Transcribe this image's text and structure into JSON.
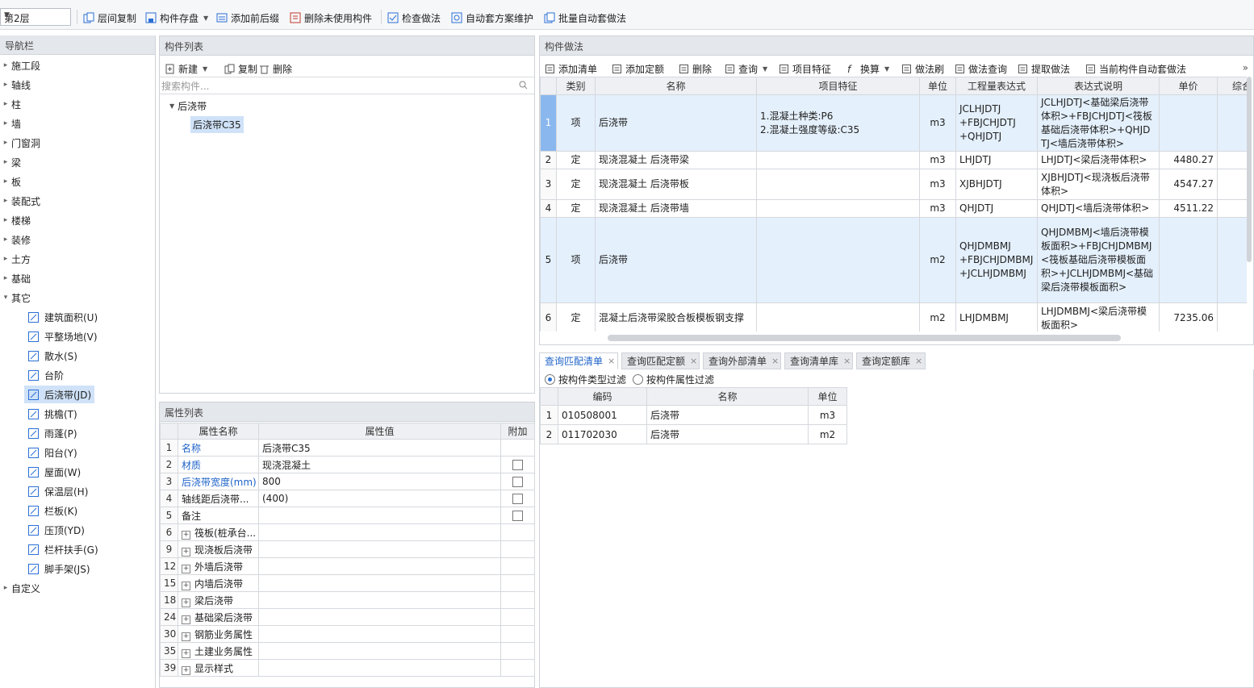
{
  "toolbar": {
    "floor": "第2层",
    "items": [
      "层间复制",
      "构件存盘",
      "添加前后缀",
      "删除未使用构件",
      "检查做法",
      "自动套方案维护",
      "批量自动套做法"
    ]
  },
  "nav": {
    "title": "导航栏",
    "items": [
      "施工段",
      "轴线",
      "柱",
      "墙",
      "门窗洞",
      "梁",
      "板",
      "装配式",
      "楼梯",
      "装修",
      "土方",
      "基础",
      "其它"
    ],
    "sub_items": [
      "建筑面积(U)",
      "平整场地(V)",
      "散水(S)",
      "台阶",
      "后浇带(JD)",
      "挑檐(T)",
      "雨蓬(P)",
      "阳台(Y)",
      "屋面(W)",
      "保温层(H)",
      "栏板(K)",
      "压顶(YD)",
      "栏杆扶手(G)",
      "脚手架(JS)"
    ],
    "custom": "自定义"
  },
  "component_list": {
    "title": "构件列表",
    "new": "新建",
    "copy": "复制",
    "delete": "删除",
    "search_placeholder": "搜索构件...",
    "tree_parent": "后浇带",
    "tree_child": "后浇带C35"
  },
  "property_list": {
    "title": "属性列表",
    "headers": [
      "属性名称",
      "属性值",
      "附加"
    ],
    "rows": [
      {
        "no": "1",
        "name": "名称",
        "value": "后浇带C35"
      },
      {
        "no": "2",
        "name": "材质",
        "value": "现浇混凝土"
      },
      {
        "no": "3",
        "name": "后浇带宽度(mm)",
        "value": "800"
      },
      {
        "no": "4",
        "name": "轴线距后浇带...",
        "value": "(400)"
      },
      {
        "no": "5",
        "name": "备注",
        "value": ""
      },
      {
        "no": "6",
        "name": "筏板(桩承台...",
        "value": ""
      },
      {
        "no": "9",
        "name": "现浇板后浇带",
        "value": ""
      },
      {
        "no": "12",
        "name": "外墙后浇带",
        "value": ""
      },
      {
        "no": "15",
        "name": "内墙后浇带",
        "value": ""
      },
      {
        "no": "18",
        "name": "梁后浇带",
        "value": ""
      },
      {
        "no": "24",
        "name": "基础梁后浇带",
        "value": ""
      },
      {
        "no": "30",
        "name": "钢筋业务属性",
        "value": ""
      },
      {
        "no": "35",
        "name": "土建业务属性",
        "value": ""
      },
      {
        "no": "39",
        "name": "显示样式",
        "value": ""
      }
    ]
  },
  "method": {
    "title": "构件做法",
    "toolbar": [
      "添加清单",
      "添加定额",
      "删除",
      "查询",
      "项目特征",
      "换算",
      "做法刷",
      "做法查询",
      "提取做法",
      "当前构件自动套做法"
    ],
    "headers": [
      "类别",
      "名称",
      "项目特征",
      "单位",
      "工程量表达式",
      "表达式说明",
      "单价",
      "综合"
    ],
    "rows": [
      {
        "no": "1",
        "type": "项",
        "name": "后浇带",
        "feature": "1.混凝土种类:P6\n2.混凝土强度等级:C35",
        "unit": "m3",
        "expr": "JCLHJDTJ\n+FBJCHJDTJ\n+QHJDTJ",
        "desc": "JCLHJDTJ<基础梁后浇带体积>+FBJCHJDTJ<筏板基础后浇带体积>+QHJDTJ<墙后浇带体积>",
        "price": ""
      },
      {
        "no": "2",
        "type": "定",
        "name": "现浇混凝土 后浇带梁",
        "feature": "",
        "unit": "m3",
        "expr": "LHJDTJ",
        "desc": "LHJDTJ<梁后浇带体积>",
        "price": "4480.27"
      },
      {
        "no": "3",
        "type": "定",
        "name": "现浇混凝土 后浇带板",
        "feature": "",
        "unit": "m3",
        "expr": "XJBHJDTJ",
        "desc": "XJBHJDTJ<现浇板后浇带体积>",
        "price": "4547.27"
      },
      {
        "no": "4",
        "type": "定",
        "name": "现浇混凝土 后浇带墙",
        "feature": "",
        "unit": "m3",
        "expr": "QHJDTJ",
        "desc": "QHJDTJ<墙后浇带体积>",
        "price": "4511.22"
      },
      {
        "no": "5",
        "type": "项",
        "name": "后浇带",
        "feature": "",
        "unit": "m2",
        "expr": "QHJDMBMJ\n+FBJCHJDMBMJ\n+JCLHJDMBMJ",
        "desc": "QHJDMBMJ<墙后浇带模板面积>+FBJCHJDMBMJ<筏板基础后浇带模板面积>+JCLHJDMBMJ<基础梁后浇带模板面积>",
        "price": ""
      },
      {
        "no": "6",
        "type": "定",
        "name": "混凝土后浇带梁胶合板模板钢支撑",
        "feature": "",
        "unit": "m2",
        "expr": "LHJDMBMJ",
        "desc": "LHJDMBMJ<梁后浇带模板面积>",
        "price": "7235.06"
      }
    ]
  },
  "query": {
    "tabs": [
      "查询匹配清单",
      "查询匹配定额",
      "查询外部清单",
      "查询清单库",
      "查询定额库"
    ],
    "filter_type": "按构件类型过滤",
    "filter_attr": "按构件属性过滤",
    "headers": [
      "编码",
      "名称",
      "单位"
    ],
    "rows": [
      {
        "no": "1",
        "code": "010508001",
        "name": "后浇带",
        "unit": "m3"
      },
      {
        "no": "2",
        "code": "011702030",
        "name": "后浇带",
        "unit": "m2"
      }
    ]
  }
}
